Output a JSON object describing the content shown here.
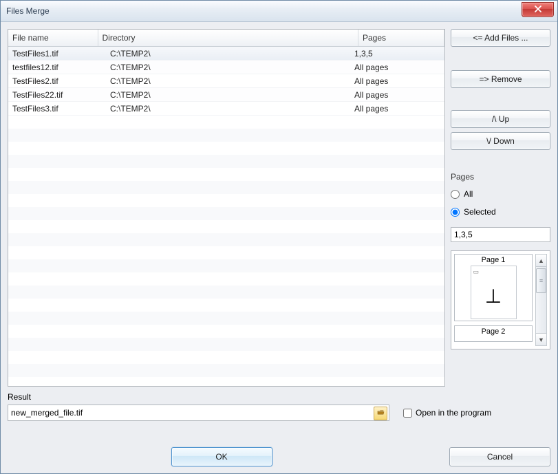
{
  "window": {
    "title": "Files Merge"
  },
  "columns": {
    "file_name": "File name",
    "directory": "Directory",
    "pages": "Pages"
  },
  "files": [
    {
      "name": "TestFiles1.tif",
      "dir": "C:\\TEMP2\\",
      "pages": "1,3,5",
      "selected": true
    },
    {
      "name": "testfiles12.tif",
      "dir": "C:\\TEMP2\\",
      "pages": "All pages",
      "selected": false
    },
    {
      "name": "TestFiles2.tif",
      "dir": "C:\\TEMP2\\",
      "pages": "All pages",
      "selected": false
    },
    {
      "name": "TestFiles22.tif",
      "dir": "C:\\TEMP2\\",
      "pages": "All pages",
      "selected": false
    },
    {
      "name": "TestFiles3.tif",
      "dir": "C:\\TEMP2\\",
      "pages": "All pages",
      "selected": false
    }
  ],
  "buttons": {
    "add_files": "<=  Add Files ...",
    "remove": "=>   Remove",
    "up": "/\\   Up",
    "down": "\\/   Down",
    "ok": "OK",
    "cancel": "Cancel"
  },
  "pages_panel": {
    "label": "Pages",
    "all_label": "All",
    "selected_label": "Selected",
    "mode": "Selected",
    "selected_value": "1,3,5"
  },
  "preview": {
    "page1_label": "Page 1",
    "page2_label": "Page 2"
  },
  "result": {
    "label": "Result",
    "value": "new_merged_file.tif",
    "open_label": "Open in the program",
    "open_checked": false
  }
}
